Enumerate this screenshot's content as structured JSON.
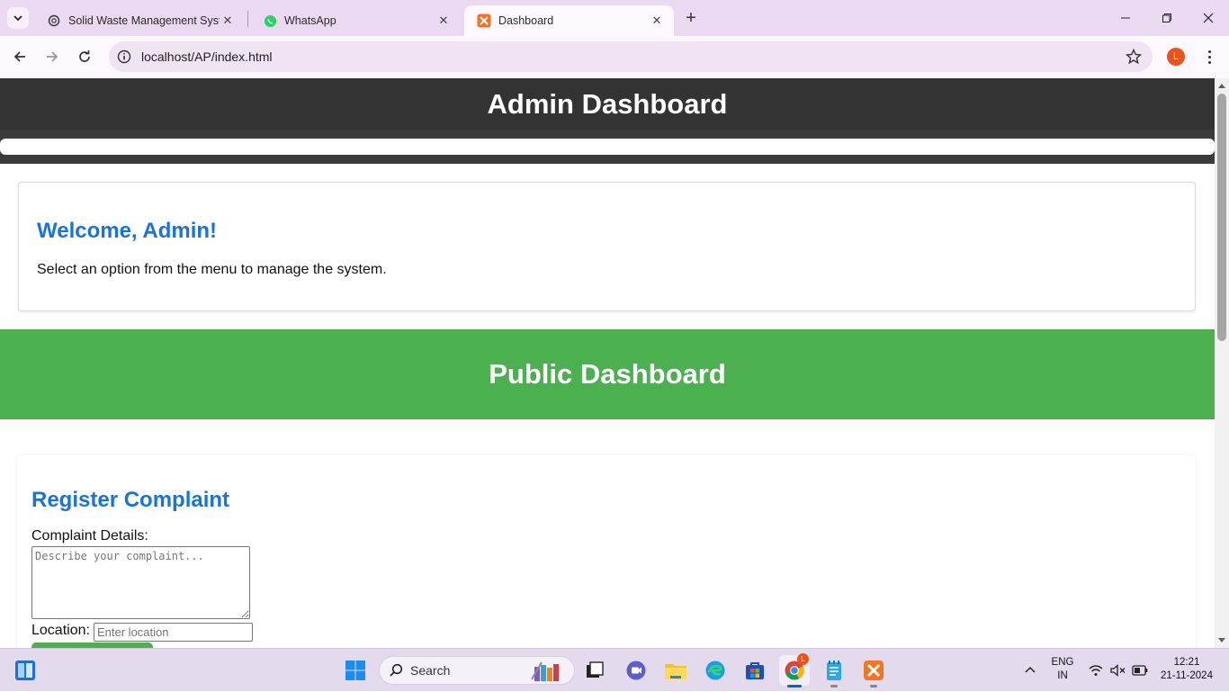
{
  "browser": {
    "tabs": [
      {
        "title": "Solid Waste Management Syste",
        "icon": "openai-icon"
      },
      {
        "title": "WhatsApp",
        "icon": "whatsapp-icon"
      },
      {
        "title": "Dashboard",
        "icon": "xampp-icon"
      }
    ],
    "url": "localhost/AP/index.html",
    "profile_initial": "L"
  },
  "page": {
    "admin_title": "Admin Dashboard",
    "welcome_heading": "Welcome, Admin!",
    "welcome_text": "Select an option from the menu to manage the system.",
    "public_title": "Public Dashboard",
    "complaint": {
      "heading": "Register Complaint",
      "details_label": "Complaint Details:",
      "details_placeholder": "Describe your complaint...",
      "location_label": "Location:",
      "location_placeholder": "Enter location"
    }
  },
  "taskbar": {
    "search_label": "Search",
    "lang_line1": "ENG",
    "lang_line2": "IN",
    "time": "12:21",
    "date": "21-11-2024",
    "chrome_badge": "L"
  },
  "colors": {
    "admin_header": "#333333",
    "public_header": "#4caf50",
    "heading_blue": "#1a73d6"
  }
}
